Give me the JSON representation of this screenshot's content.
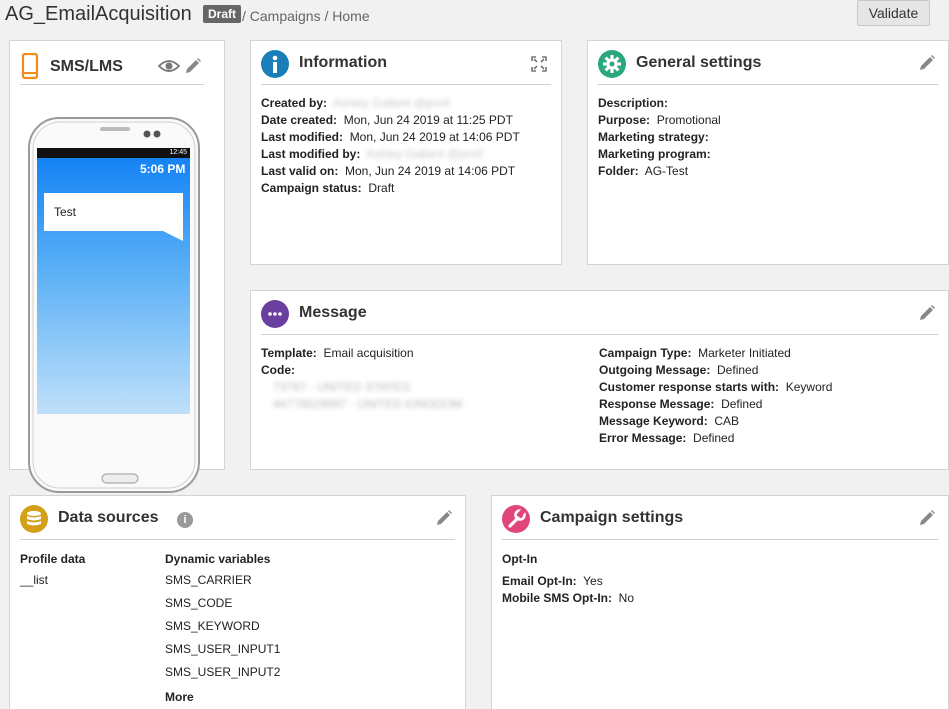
{
  "header": {
    "title": "AG_EmailAcquisition",
    "status_badge": "Draft",
    "breadcrumb": "/ Campaigns / Home",
    "validate_label": "Validate"
  },
  "sms_panel": {
    "title": "SMS/LMS",
    "phone_time": "5:06 PM",
    "status_time": "12:45",
    "message_text": "Test"
  },
  "information": {
    "title": "Information",
    "fields": [
      {
        "label": "Created by:",
        "value": "Ashley Gallant @pmX",
        "redacted": true
      },
      {
        "label": "Date created:",
        "value": "Mon, Jun 24 2019 at 11:25 PDT"
      },
      {
        "label": "Last modified:",
        "value": "Mon, Jun 24 2019 at 14:06 PDT"
      },
      {
        "label": "Last modified by:",
        "value": "Ashley Gallant @pmX",
        "redacted": true
      },
      {
        "label": "Last valid on:",
        "value": "Mon, Jun 24 2019 at 14:06 PDT"
      },
      {
        "label": "Campaign status:",
        "value": "Draft"
      }
    ]
  },
  "general": {
    "title": "General settings",
    "fields": [
      {
        "label": "Description:",
        "value": ""
      },
      {
        "label": "Purpose:",
        "value": "Promotional"
      },
      {
        "label": "Marketing strategy:",
        "value": ""
      },
      {
        "label": "Marketing program:",
        "value": ""
      },
      {
        "label": "Folder:",
        "value": "AG-Test"
      }
    ]
  },
  "message": {
    "title": "Message",
    "template_label": "Template:",
    "template_value": "Email acquisition",
    "code_label": "Code:",
    "codes": [
      "73787 - UNITED STATES",
      "44778029997 - UNITED KINGDOM"
    ],
    "right_fields": [
      {
        "label": "Campaign Type:",
        "value": "Marketer Initiated"
      },
      {
        "label": "Outgoing Message:",
        "value": "Defined"
      },
      {
        "label": "Customer response starts with:",
        "value": "Keyword"
      },
      {
        "label": "Response Message:",
        "value": "Defined"
      },
      {
        "label": "Message Keyword:",
        "value": "CAB"
      },
      {
        "label": "Error Message:",
        "value": "Defined"
      }
    ]
  },
  "data_sources": {
    "title": "Data sources",
    "profile_header": "Profile data",
    "profile_items": [
      "__list"
    ],
    "dynamic_header": "Dynamic variables",
    "dynamic_items": [
      "SMS_CARRIER",
      "SMS_CODE",
      "SMS_KEYWORD",
      "SMS_USER_INPUT1",
      "SMS_USER_INPUT2"
    ],
    "more_label": "More"
  },
  "campaign_settings": {
    "title": "Campaign settings",
    "section": "Opt-In",
    "fields": [
      {
        "label": "Email Opt-In:",
        "value": "Yes"
      },
      {
        "label": "Mobile SMS Opt-In:",
        "value": "No"
      }
    ]
  },
  "colors": {
    "info_icon": "#1a7fb8",
    "general_icon": "#2aa87c",
    "message_icon": "#6b3fa0",
    "data_icon": "#d4a017",
    "campaign_icon": "#e0457b",
    "sms_icon": "#f08c1a"
  }
}
